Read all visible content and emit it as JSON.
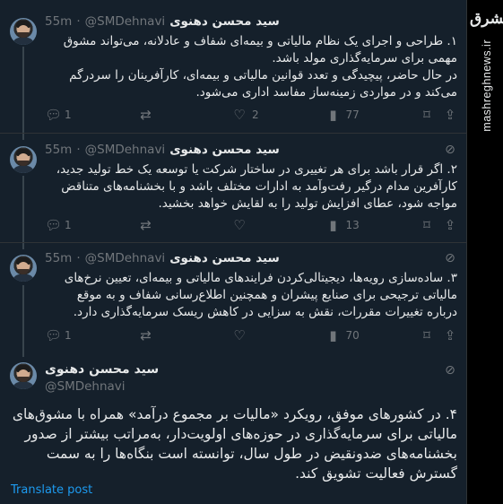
{
  "watermark": {
    "logo": "مشرق",
    "site": "mashreghnews.ir"
  },
  "author": {
    "name": "سید محسن دهنوی",
    "handle": "@SMDehnavi"
  },
  "thread": [
    {
      "time": "55m",
      "paragraphs": [
        "۱. طراحی و اجرای یک نظام مالیاتی و بیمه‌ای شفاف و عادلانه، می‌تواند مشوق مهمی برای سرمایه‌گذاری مولد باشد.",
        "در حال حاضر، پیچیدگی و تعدد قوانین مالیاتی و بیمه‌ای، کارآفرینان را سردرگم می‌کند و در مواردی زمینه‌ساز مفاسد اداری می‌شود."
      ],
      "replies": "1",
      "reposts": "",
      "likes": "2",
      "views": "77"
    },
    {
      "time": "55m",
      "paragraphs": [
        "۲. اگر قرار باشد برای هر تغییری در ساختار شرکت یا توسعه یک خط تولید جدید، کارآفرین مدام درگیر رفت‌وآمد به ادارات مختلف باشد و با بخشنامه‌های متناقض مواجه شود، عطای افزایش تولید را به لقایش خواهد بخشید."
      ],
      "replies": "1",
      "reposts": "",
      "likes": "",
      "views": "13"
    },
    {
      "time": "55m",
      "paragraphs": [
        "۳. ساده‌سازی رویه‌ها، دیجیتالی‌کردن فرایندهای مالیاتی و بیمه‌ای، تعیین نرخ‌های مالیاتی ترجیحی برای صنایع پیشران و همچنین اطلاع‌رسانی شفاف و به موقع درباره تغییرات مقررات، نقش به سزایی در کاهش ریسک سرمایه‌گذاری دارد."
      ],
      "replies": "1",
      "reposts": "",
      "likes": "",
      "views": "70"
    }
  ],
  "main_post": {
    "text": "۴. در کشورهای موفق، رویکرد «مالیات بر مجموع درآمد» همراه با مشوق‌های مالیاتی برای سرمایه‌گذاری در حوزه‌های اولویت‌دار، به‌مراتب بیشتر از صدور بخشنامه‌های ضدونقیض در طول سال، توانسته است بنگاه‌ها را به سمت گسترش فعالیت تشویق کند.",
    "translate_label": "Translate post"
  },
  "icons": [
    "reply-icon",
    "repost-icon",
    "like-icon",
    "views-icon",
    "bookmark-icon",
    "share-icon",
    "grok-icon"
  ],
  "colors": {
    "background": "#15202b",
    "text": "#e7e9ea",
    "muted": "#71767b",
    "link": "#1d9bf0",
    "divider": "#2f3336"
  }
}
